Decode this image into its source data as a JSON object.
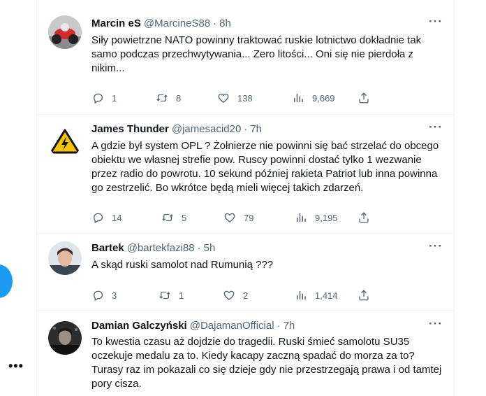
{
  "sidebar": {
    "more_label": "•••"
  },
  "tweets": [
    {
      "name": "Marcin eS",
      "handle": "@MarcineS88",
      "time": "8h",
      "text": "Siły powietrzne NATO powinny traktować ruskie lotnictwo dokładnie tak samo podczas przechwytywania... Zero litości... Oni się nie pierdoła z nikim...",
      "replies": "1",
      "retweets": "8",
      "likes": "138",
      "views": "9,669"
    },
    {
      "name": "James Thunder",
      "handle": "@jamesacid20",
      "time": "7h",
      "text": "A gdzie był system OPL ? Żołnierze nie powinni się bać strzelać do obcego obiektu we własnej strefie pow.  Ruscy powinni dostać tylko 1 wezwanie przez radio do powrotu. 10 sekund później rakieta Patriot lub inna powinna go zestrzelić. Bo wkrótce będą mieli więcej takich zdarzeń.",
      "replies": "14",
      "retweets": "5",
      "likes": "79",
      "views": "9,195"
    },
    {
      "name": "Bartek",
      "handle": "@bartekfazi88",
      "time": "5h",
      "text": "A skąd ruski samolot nad Rumunią ???",
      "replies": "3",
      "retweets": "1",
      "likes": "2",
      "views": "1,414"
    },
    {
      "name": "Damian Galczyński",
      "handle": "@DajamanOfficial",
      "time": "7h",
      "text": "To kwestia czasu aż dojdzie do tragedii. Ruski śmieć samolotu SU35 oczekuje medalu za to. Kiedy kacapy zaczną spadać do morza za to? Turasy raz im pokazali co się dzieje gdy nie przestrzegają prawa i od tamtej pory cisza."
    }
  ],
  "colors": {
    "accent": "#1d9bf0",
    "text": "#0f1419",
    "secondary": "#536471",
    "border": "#eff3f4"
  }
}
